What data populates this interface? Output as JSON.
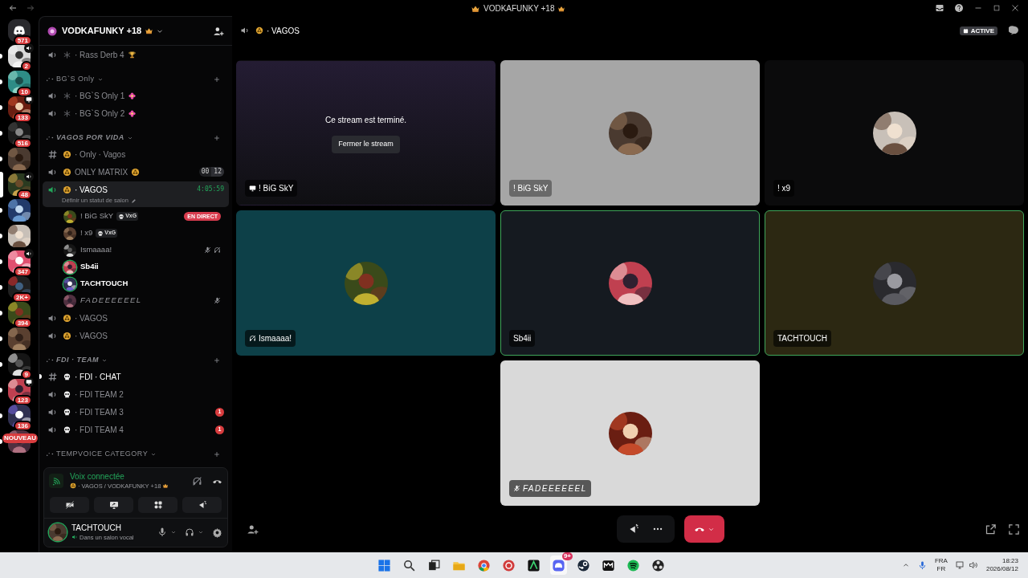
{
  "window": {
    "title": "VODKAFUNKY +18"
  },
  "rail": [
    {
      "kind": "home",
      "badge": "571",
      "unread": false,
      "selected": false
    },
    {
      "kind": "server",
      "badge": "2",
      "unread": true,
      "selected": false
    },
    {
      "kind": "server",
      "badge": "10",
      "unread": true,
      "selected": false
    },
    {
      "kind": "server",
      "badge": "133",
      "unread": true,
      "selected": false
    },
    {
      "kind": "server",
      "badge": "516",
      "unread": true,
      "selected": false
    },
    {
      "kind": "server",
      "unread": true,
      "selected": false
    },
    {
      "kind": "server",
      "badge": "48",
      "selected": true
    },
    {
      "kind": "server",
      "unread": true,
      "selected": false
    },
    {
      "kind": "server",
      "unread": true,
      "selected": false
    },
    {
      "kind": "server",
      "badge": "347",
      "unread": true,
      "selected": false
    },
    {
      "kind": "server",
      "badge": "2K+",
      "unread": true,
      "selected": false
    },
    {
      "kind": "server",
      "badge": "394",
      "unread": true,
      "selected": false
    },
    {
      "kind": "server",
      "unread": true,
      "selected": false
    },
    {
      "kind": "server",
      "badge": "9",
      "unread": true,
      "selected": false
    },
    {
      "kind": "server",
      "badge": "123",
      "unread": true,
      "selected": false
    },
    {
      "kind": "server",
      "badge": "136",
      "unread": true,
      "selected": false
    },
    {
      "kind": "new",
      "label": "NOUVEAU",
      "unread": true,
      "selected": false
    }
  ],
  "server": {
    "name": "VODKAFUNKY +18"
  },
  "channels": [
    {
      "kind": "voice",
      "name": "· Rass Derb 4",
      "selected": false,
      "unread": false
    },
    {
      "kind": "category",
      "name": "BG`S Only",
      "italic": false
    },
    {
      "kind": "voice",
      "name": "· BG`S Only 1",
      "selected": false,
      "unread": false
    },
    {
      "kind": "voice",
      "name": "· BG`S Only 2",
      "selected": false,
      "unread": false
    },
    {
      "kind": "category",
      "name": "VAGOS POR VIDA",
      "italic": true
    },
    {
      "kind": "text",
      "name": "· Only · Vagos",
      "selected": false,
      "unread": false
    },
    {
      "kind": "voice",
      "name": "ONLY MATRIX",
      "selected": false,
      "unread": false,
      "counter": [
        "00",
        "12"
      ]
    },
    {
      "kind": "voice",
      "name": "· VAGOS",
      "selected": true,
      "unread": true,
      "timer": "4:05:59",
      "status": "Définir un statut de salon"
    },
    {
      "kind": "member",
      "name": "! BiG SkY",
      "tag": "VxG",
      "live": "EN DIRECT",
      "speaking": false,
      "muted": false,
      "deafened": false,
      "italic": false
    },
    {
      "kind": "member",
      "name": "! x9",
      "tag": "VxG",
      "speaking": false,
      "muted": false,
      "deafened": false,
      "italic": false
    },
    {
      "kind": "member",
      "name": "Ismaaaa!",
      "speaking": false,
      "muted": true,
      "deafened": true,
      "italic": false
    },
    {
      "kind": "member",
      "name": "Sb4ii",
      "speaking": true,
      "muted": false,
      "deafened": false,
      "italic": false
    },
    {
      "kind": "member",
      "name": "TACHTOUCH",
      "speaking": true,
      "muted": false,
      "deafened": false,
      "italic": false
    },
    {
      "kind": "member",
      "name": "FADEEEEEEL",
      "speaking": false,
      "muted": true,
      "deafened": false,
      "italic": true
    },
    {
      "kind": "voice",
      "name": "· VAGOS",
      "selected": false,
      "unread": false
    },
    {
      "kind": "voice",
      "name": "· VAGOS",
      "selected": false,
      "unread": false
    },
    {
      "kind": "category",
      "name": "FDI · TEAM",
      "italic": true
    },
    {
      "kind": "text",
      "name": "· FDI · CHAT",
      "selected": false,
      "unread": true
    },
    {
      "kind": "voice",
      "name": "· FDI TEAM 2",
      "selected": false,
      "unread": false
    },
    {
      "kind": "voice",
      "name": "· FDI TEAM 3",
      "selected": false,
      "unread": false,
      "mentions": "1"
    },
    {
      "kind": "voice",
      "name": "· FDI TEAM 4",
      "selected": false,
      "unread": false,
      "mentions": "1"
    },
    {
      "kind": "category",
      "name": "TEMPVOICE CATEGORY",
      "italic": false
    }
  ],
  "voice_panel": {
    "status": "Voix connectée",
    "location": "· VAGOS / VODKAFUNKY +18"
  },
  "user": {
    "name": "TACHTOUCH",
    "status": "Dans un salon vocal"
  },
  "call": {
    "channel": "· VAGOS",
    "badge": "ACTIVE",
    "tiles": [
      {
        "kind": "ended",
        "message": "Ce stream est terminé.",
        "button": "Fermer le stream",
        "label": "! BiG SkY",
        "speaking": false
      },
      {
        "kind": "avatar",
        "label": "! BiG SkY",
        "speaking": false,
        "color": "#a6a6a6"
      },
      {
        "kind": "avatar",
        "label": "! x9",
        "speaking": false,
        "color": "#0b0b0c"
      },
      {
        "kind": "avatar",
        "label": "Ismaaaa!",
        "speaking": false,
        "color": "#0d4048"
      },
      {
        "kind": "avatar",
        "label": "Sb4ii",
        "speaking": true,
        "color": "#151a20"
      },
      {
        "kind": "avatar",
        "label": "TACHTOUCH",
        "speaking": true,
        "color": "#2c2812"
      },
      {
        "kind": "avatar",
        "label": "FADEEEEEEL",
        "speaking": false,
        "color": "#d9d9d9"
      }
    ]
  },
  "taskbar": {
    "discord_badge": "9+",
    "language": "FRA",
    "layout": "FR",
    "time": "18:23",
    "date": "2026/08/12"
  }
}
